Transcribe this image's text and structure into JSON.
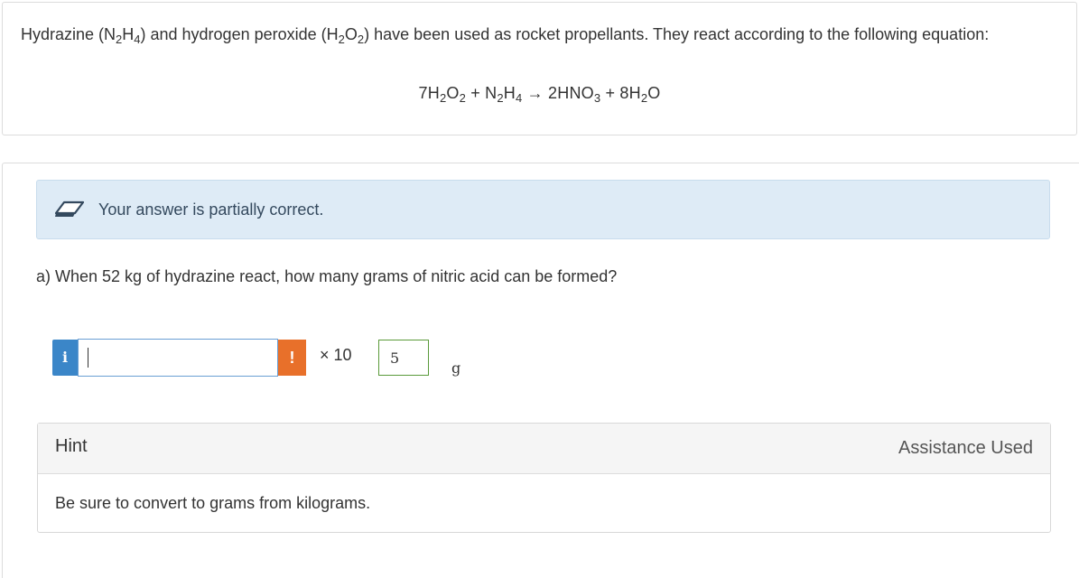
{
  "question": {
    "intro_1": "Hydrazine (N",
    "intro_sub1": "2",
    "intro_2": "H",
    "intro_sub2": "4",
    "intro_3": ") and hydrogen peroxide (H",
    "intro_sub3": "2",
    "intro_4": "O",
    "intro_sub4": "2",
    "intro_5": ") have been used as rocket propellants. They react according to the following equation:",
    "equation": {
      "t1": "7H",
      "s1": "2",
      "t2": "O",
      "s2": "2",
      "t3": " + N",
      "s3": "2",
      "t4": "H",
      "s4": "4",
      "t5": " → 2HNO",
      "s5": "3",
      "t6": " + 8H",
      "s6": "2",
      "t7": "O"
    }
  },
  "feedback": {
    "message": "Your answer is partially correct."
  },
  "part_a": {
    "question": "a) When 52 kg of hydrazine react, how many grams of nitric acid can be formed?",
    "info_label": "i",
    "answer_value": "",
    "warning_label": "!",
    "multiplier_label": "× 10",
    "exponent_value": "5",
    "unit_label": "g"
  },
  "hint": {
    "title": "Hint",
    "status": "Assistance Used",
    "body": "Be sure to convert to grams from kilograms."
  },
  "colors": {
    "feedback_bg": "#deebf6",
    "info_blue": "#3b86c8",
    "warning_orange": "#e8702a",
    "exponent_border_green": "#5a9a3a"
  }
}
